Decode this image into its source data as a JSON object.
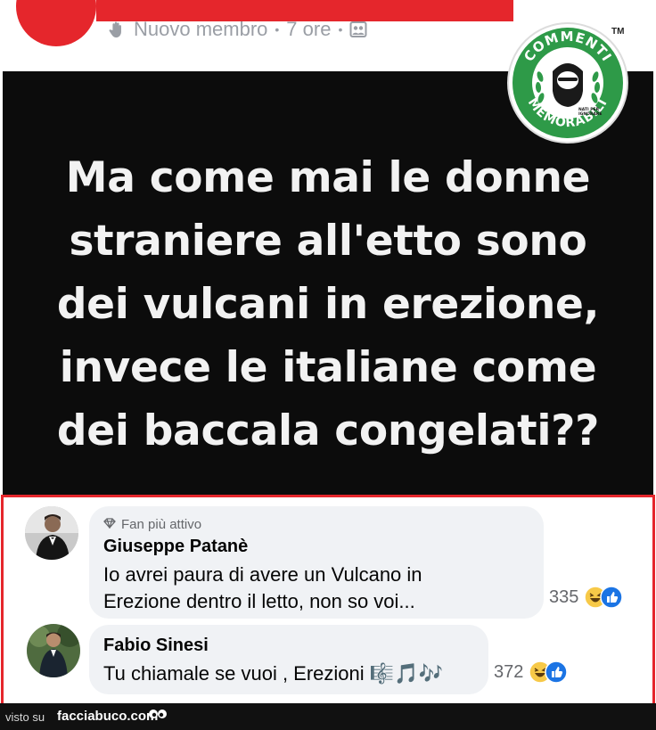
{
  "post": {
    "meta": {
      "badge_text": "Nuovo membro",
      "time": "7 ore",
      "separator": "•"
    },
    "image_text_lines": [
      "Ma come mai le donne",
      "straniere all'etto sono",
      "dei vulcani in erezione,",
      "invece le italiane come",
      "dei baccala congelati??"
    ],
    "logo": {
      "top_text": "COMMENTI",
      "bottom_text": "MEMORABILI",
      "tag_line_1": "NATI PER",
      "tag_line_2": "IGNORARE",
      "trademark": "TM"
    }
  },
  "comments": [
    {
      "badge": "Fan più attivo",
      "author": "Giuseppe Patanè",
      "lines": [
        "Io avrei paura di avere un Vulcano in",
        "Erezione dentro il letto, non so voi..."
      ],
      "reaction_count": "335"
    },
    {
      "badge": "",
      "author": "Fabio Sinesi",
      "lines": [
        "Tu chiamale se vuoi , Erezioni 🎼🎵🎶"
      ],
      "reaction_count": "372"
    }
  ],
  "footer": {
    "seen_on": "visto su",
    "site": "facciabuco.com"
  },
  "colors": {
    "highlight_red": "#e5262c",
    "post_bg": "#0c0c0c",
    "bubble_bg": "#f0f2f5",
    "logo_green": "#2e9a48"
  },
  "icons": [
    "new-member-wave-icon",
    "group-privacy-icon",
    "diamond-badge-icon",
    "haha-reaction-icon",
    "like-reaction-icon",
    "eyes-logo-icon"
  ]
}
